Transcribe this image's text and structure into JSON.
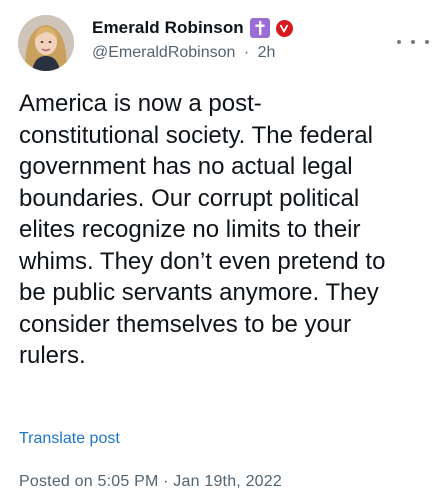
{
  "author": {
    "display_name": "Emerald Robinson",
    "handle": "@EmeraldRobinson",
    "separator": "·",
    "time_ago": "2h",
    "badges": [
      "cross-icon",
      "verified-v-icon"
    ]
  },
  "tweet": {
    "line_1": "America is now a post-",
    "line_2": "constitutional society. The federal",
    "line_3": "government has no actual legal",
    "line_4": "boundaries. Our corrupt political",
    "line_5": "elites recognize no limits to their",
    "line_6": "whims. They don’t even pretend to",
    "line_7": "be public servants anymore. They",
    "line_8": "consider themselves to be your",
    "line_9": "rulers."
  },
  "translate_label": "Translate post",
  "posted": {
    "text": "Posted on 5:05 PM · Jan 19th, 2022"
  },
  "colors": {
    "text": "#0f1419",
    "secondary": "#536471",
    "link": "#1d77c9",
    "cross_badge": "#9b6dd6",
    "v_badge": "#d9191f"
  }
}
